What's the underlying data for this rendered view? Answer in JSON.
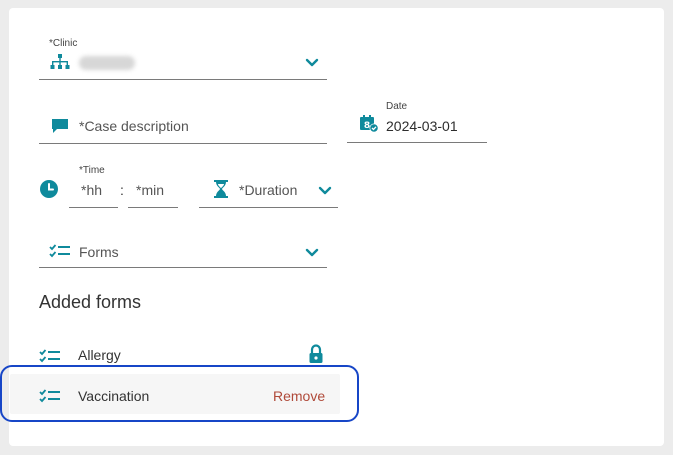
{
  "colors": {
    "accent": "#0f8a9c",
    "remove": "#b04a3a",
    "highlight_border": "#1746c7"
  },
  "clinic": {
    "label": "*Clinic",
    "icon": "sitemap-icon",
    "dropdown_icon": "chevron-down-icon"
  },
  "case_description": {
    "placeholder": "*Case description",
    "icon": "comment-icon"
  },
  "date": {
    "label": "Date",
    "value": "2024-03-01",
    "icon": "calendar-check-icon"
  },
  "time": {
    "label": "*Time",
    "hours_placeholder": "*hh",
    "separator": ":",
    "minutes_placeholder": "*min",
    "icon": "clock-icon"
  },
  "duration": {
    "placeholder": "*Duration",
    "icon": "hourglass-icon",
    "dropdown_icon": "chevron-down-icon"
  },
  "forms": {
    "placeholder": "Forms",
    "icon": "checklist-icon",
    "dropdown_icon": "chevron-down-icon"
  },
  "added_forms": {
    "title": "Added forms",
    "items": [
      {
        "name": "Allergy",
        "icon": "checklist-icon",
        "status_icon": "lock-icon"
      },
      {
        "name": "Vaccination",
        "icon": "checklist-icon",
        "action": "Remove"
      }
    ]
  }
}
